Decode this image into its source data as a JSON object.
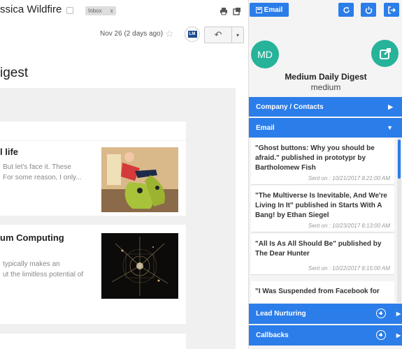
{
  "mail": {
    "sender": "ssica Wildfire",
    "label": "Inbox",
    "label_close": "x",
    "date": "Nov 26 (2 days ago)",
    "star": "☆",
    "ext_badge": "LM",
    "reply": "↶",
    "more": "▾",
    "subject": "igest",
    "cards": [
      {
        "title": "l life",
        "snippet_line1": "But let's face it. These",
        "snippet_line2": "For some reason, I only..."
      },
      {
        "title": "um Computing",
        "snippet_line1": "typically makes an",
        "snippet_line2": "ut the limitless potential of"
      }
    ]
  },
  "crm": {
    "email_tab": "Email",
    "avatar_initials": "MD",
    "contact_name": "Medium Daily Digest",
    "contact_sub": "medium",
    "sections": {
      "company": "Company / Contacts",
      "email": "Email",
      "lead": "Lead Nurturing",
      "callbacks": "Callbacks"
    },
    "emails": [
      {
        "title": "\"Ghost buttons: Why you should be afraid.\" published in prototypr by Bartholomew Fish",
        "sent": "Sent on : 10/21/2017 8:21:00 AM"
      },
      {
        "title": "\"The Multiverse Is Inevitable, And We're Living In It\" published in Starts With A Bang! by Ethan Siegel",
        "sent": "Sent on : 10/23/2017 8:13:00 AM"
      },
      {
        "title": "\"All Is As All Should Be\" published by The Dear Hunter",
        "sent": "Sent on : 10/22/2017 8:15:00 AM"
      },
      {
        "title": "\"I Was Suspended from Facebook for",
        "sent": ""
      }
    ]
  },
  "colors": {
    "accent_blue": "#2b7de9",
    "teal": "#26b39a"
  }
}
